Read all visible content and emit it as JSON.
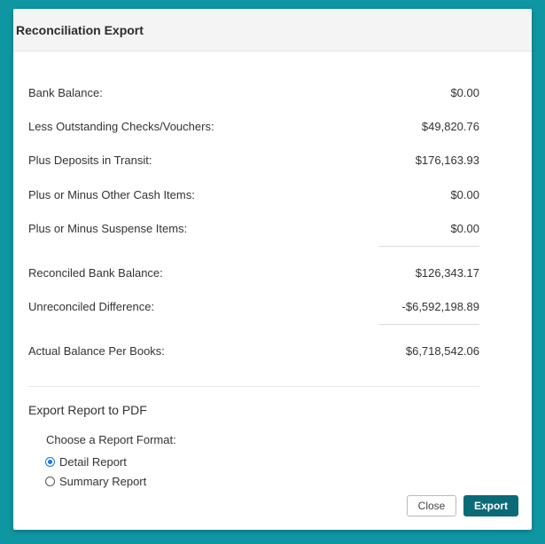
{
  "dialog": {
    "title": "Reconciliation Export"
  },
  "summary": {
    "bank_balance": {
      "label": "Bank Balance:",
      "value": "$0.00"
    },
    "outstanding_checks": {
      "label": "Less Outstanding Checks/Vouchers:",
      "value": "$49,820.76"
    },
    "deposits_in_transit": {
      "label": "Plus Deposits in Transit:",
      "value": "$176,163.93"
    },
    "other_cash_items": {
      "label": "Plus or Minus Other Cash Items:",
      "value": "$0.00"
    },
    "suspense_items": {
      "label": "Plus or Minus Suspense Items:",
      "value": "$0.00"
    },
    "reconciled_bank_balance": {
      "label": "Reconciled Bank Balance:",
      "value": "$126,343.17"
    },
    "unreconciled_difference": {
      "label": "Unreconciled Difference:",
      "value": "-$6,592,198.89"
    },
    "actual_balance_books": {
      "label": "Actual Balance Per Books:",
      "value": "$6,718,542.06"
    }
  },
  "export": {
    "title": "Export Report to PDF",
    "choose_label": "Choose a Report Format:",
    "options": {
      "detail": {
        "label": "Detail Report",
        "selected": true
      },
      "summary": {
        "label": "Summary Report",
        "selected": false
      }
    }
  },
  "buttons": {
    "close": "Close",
    "export": "Export"
  },
  "colors": {
    "background": "#0e97a3",
    "primary_button": "#0b6a77",
    "radio_selected": "#1a73e8"
  }
}
